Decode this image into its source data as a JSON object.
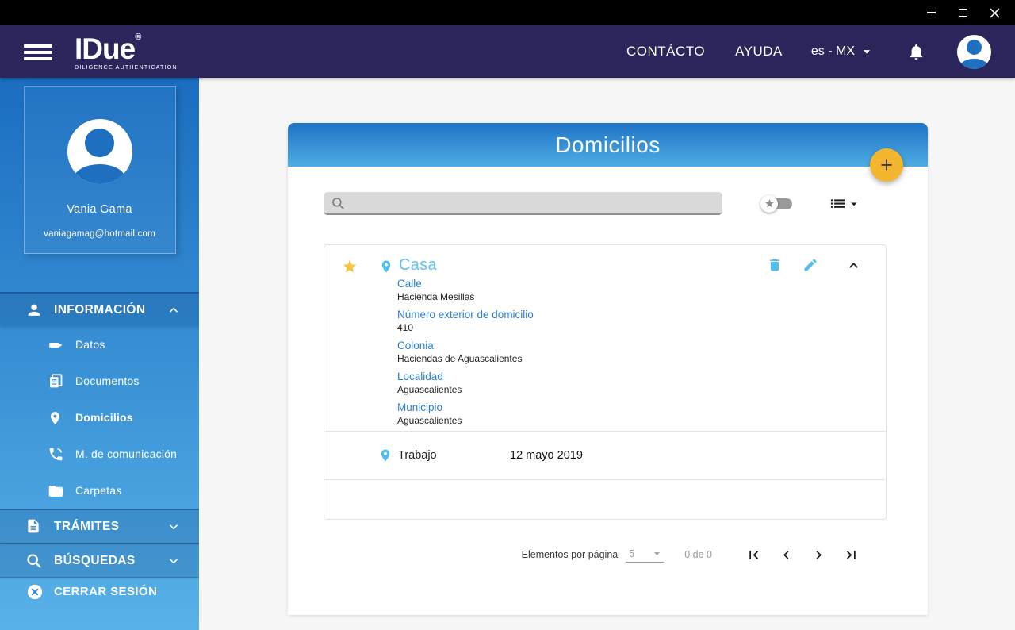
{
  "titlebar": {
    "controls": [
      {
        "name": "minimize"
      },
      {
        "name": "maximize"
      },
      {
        "name": "close"
      }
    ]
  },
  "navbar": {
    "logo": {
      "text": "IDue",
      "mark": "®",
      "tagline": "DILIGENCE AUTHENTICATION"
    },
    "contact_label": "CONTÁCTO",
    "help_label": "AYUDA",
    "language": {
      "value": "es - MX"
    }
  },
  "sidebar": {
    "profile": {
      "name": "Vania Gama",
      "email": "vaniagamag@hotmail.com"
    },
    "sections": [
      {
        "label": "INFORMACIÓN",
        "state": "expanded",
        "items": [
          {
            "label": "Datos",
            "icon": "card-icon",
            "active": false
          },
          {
            "label": "Documentos",
            "icon": "documents-icon",
            "active": false
          },
          {
            "label": "Domicilios",
            "icon": "location-pin-icon",
            "active": true
          },
          {
            "label": "M. de comunicación",
            "icon": "phone-icon",
            "active": false
          },
          {
            "label": "Carpetas",
            "icon": "folder-icon",
            "active": false
          }
        ]
      },
      {
        "label": "TRÁMITES",
        "state": "collapsed",
        "icon": "document-icon"
      },
      {
        "label": "BÚSQUEDAS",
        "state": "collapsed",
        "icon": "search-icon"
      }
    ],
    "logout_label": "CERRAR SESIÓN"
  },
  "main": {
    "title": "Domicilios",
    "fab_label": "+",
    "search": {
      "value": "",
      "placeholder": ""
    },
    "favorites_toggle": {
      "on": false
    },
    "addresses": [
      {
        "name": "Casa",
        "favorite": true,
        "expanded": true,
        "fields": [
          {
            "label": "Calle",
            "value": "Hacienda Mesillas"
          },
          {
            "label": "Número exterior de domicilio",
            "value": "410"
          },
          {
            "label": "Colonia",
            "value": "Haciendas de Aguascalientes"
          },
          {
            "label": "Localidad",
            "value": "Aguascalientes"
          },
          {
            "label": "Municipio",
            "value": "Aguascalientes"
          }
        ]
      },
      {
        "name": "Trabajo",
        "date": "12 mayo 2019",
        "favorite": false,
        "expanded": false
      }
    ],
    "pagination": {
      "per_page_label": "Elementos por página",
      "per_page_value": "5",
      "range_label": "0 de 0"
    }
  },
  "colors": {
    "navy": "#2a265c",
    "sidebar_top": "#1a6dc0",
    "sidebar_bottom": "#58b2e8",
    "header_gradient_top": "#1e73c5",
    "header_gradient_bottom": "#4fade3",
    "light_blue_accent": "#53bdeb",
    "label_blue": "#2d7fd2",
    "fab_orange": "#f4b62f",
    "star_gold": "#f5c645"
  }
}
